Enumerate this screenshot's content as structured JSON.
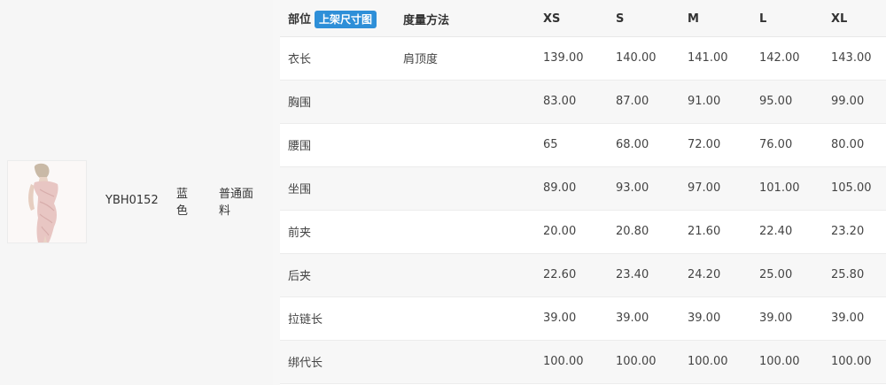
{
  "product": {
    "sku": "YBH0152",
    "color": "蓝色",
    "fabric": "普通面料"
  },
  "table": {
    "headers": {
      "part": "部位",
      "badge": "上架尺寸图",
      "method": "度量方法",
      "sizes": [
        "XS",
        "S",
        "M",
        "L",
        "XL"
      ]
    },
    "rows": [
      {
        "part": "衣长",
        "method": "肩顶度",
        "values": [
          "139.00",
          "140.00",
          "141.00",
          "142.00",
          "143.00"
        ]
      },
      {
        "part": "胸围",
        "method": "",
        "values": [
          "83.00",
          "87.00",
          "91.00",
          "95.00",
          "99.00"
        ]
      },
      {
        "part": "腰围",
        "method": "",
        "values": [
          "65",
          "68.00",
          "72.00",
          "76.00",
          "80.00"
        ]
      },
      {
        "part": "坐围",
        "method": "",
        "values": [
          "89.00",
          "93.00",
          "97.00",
          "101.00",
          "105.00"
        ]
      },
      {
        "part": "前夹",
        "method": "",
        "values": [
          "20.00",
          "20.80",
          "21.60",
          "22.40",
          "23.20"
        ]
      },
      {
        "part": "后夹",
        "method": "",
        "values": [
          "22.60",
          "23.40",
          "24.20",
          "25.00",
          "25.80"
        ]
      },
      {
        "part": "拉链长",
        "method": "",
        "values": [
          "39.00",
          "39.00",
          "39.00",
          "39.00",
          "39.00"
        ]
      },
      {
        "part": "绑代长",
        "method": "",
        "values": [
          "100.00",
          "100.00",
          "100.00",
          "100.00",
          "100.00"
        ]
      }
    ]
  }
}
